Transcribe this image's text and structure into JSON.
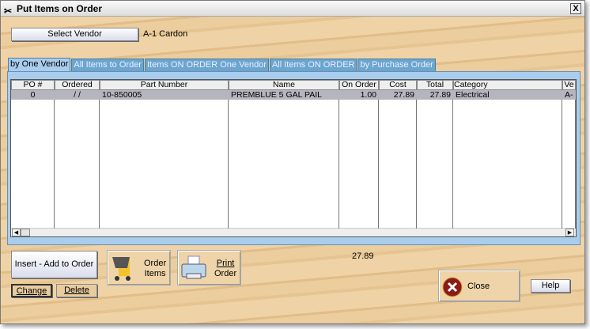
{
  "window": {
    "title": "Put Items on Order",
    "close_glyph": "X"
  },
  "vendor": {
    "select_label": "Select Vendor",
    "selected": "A-1 Cardon"
  },
  "tabs": [
    {
      "label": "by One Vendor",
      "active": true
    },
    {
      "label": "All Items to Order"
    },
    {
      "label": "Items ON ORDER One Vendor"
    },
    {
      "label": "All Items ON ORDER"
    },
    {
      "label": "by Purchase Order"
    }
  ],
  "table": {
    "columns": [
      "PO #",
      "Ordered",
      "Part Number",
      "Name",
      "On Order",
      "Cost",
      "Total",
      "Category",
      "Ve"
    ],
    "rows": [
      [
        "0",
        "/ /",
        "10-850005",
        "PREMBLUE 5 GAL PAIL",
        "1.00",
        "27.89",
        "27.89",
        "Electrical",
        "A-"
      ]
    ]
  },
  "total": "27.89",
  "buttons": {
    "insert": "Insert - Add to Order",
    "change": "Change",
    "delete": "Delete",
    "order_items_1": "Order",
    "order_items_2": "Items",
    "print_1": "Print",
    "print_2": "Order",
    "close": "Close",
    "help": "Help"
  },
  "colors": {
    "tab_active": "#a9cdee",
    "tab_inactive": "#6aa6cf",
    "selected_row": "#b5b5be"
  }
}
